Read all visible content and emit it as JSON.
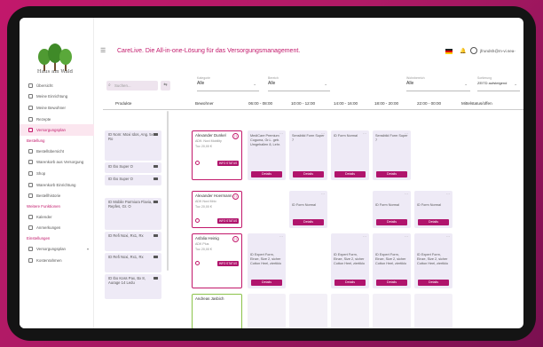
{
  "app": {
    "logo_text": "Haus am Wald",
    "tagline": "CareLive. Die All-in-one-Lösung für das Versorgungsmanagement.",
    "user": "jfrundsh@m-vi.sea-"
  },
  "sidebar": {
    "items": [
      {
        "label": "Übersicht"
      },
      {
        "label": "Meine Einrichtung"
      },
      {
        "label": "Meine Bewohner"
      },
      {
        "label": "Rezepte"
      },
      {
        "label": "Versorgungsplan",
        "active": true
      }
    ],
    "section1": "Bestellung",
    "items2": [
      {
        "label": "Bestellübersicht"
      },
      {
        "label": "Warenkorb aus Versorgung"
      },
      {
        "label": "Shop"
      },
      {
        "label": "Warenkorb Einrichtung"
      },
      {
        "label": "Bestellhistorie"
      }
    ],
    "section2": "Weitere Funktionen",
    "items3": [
      {
        "label": "Kalender"
      },
      {
        "label": "Anmerkungen"
      }
    ],
    "section3": "Einstellungen",
    "items4": [
      {
        "label": "Versorgungsplan"
      },
      {
        "label": "Kostenrahmen"
      }
    ]
  },
  "filters": {
    "search_placeholder": "Suchen...",
    "category": {
      "label": "Kategorie",
      "value": "Alle"
    },
    "section": {
      "label": "Bereich",
      "value": "Alle"
    },
    "ward": {
      "label": "Wohnbereich",
      "value": "Alle"
    },
    "sort": {
      "label": "Sortierung",
      "value": "ZEITD aufsteigend"
    }
  },
  "table": {
    "headers": [
      "Produkte",
      "Bewohner",
      "06:00 - 08:00",
      "10:00 - 12:00",
      "14:00 - 16:00",
      "18:00 - 20:00",
      "22:00 - 00:00",
      "Mittelstatus/offen"
    ],
    "products": [
      "ID Nom: Moxi Idos, Ang. 5x Ro",
      "ID Ibo Super O",
      "ID Ibo Super O",
      "ID Mobile Parmiura Flavia, 8 Repfes, Gr. O",
      "ID Refi Noxi, Rx1, Rx",
      "ID Refi Noxi, Rx1, Rx",
      "ID Ibo Koss Pax, Bx 8, Aurage 14 Ledu"
    ],
    "residents": [
      {
        "name": "Alexander Dunkel",
        "annot": "ADK: Noxi Mobility",
        "info": "Tuc 20,00 €",
        "status": "INFO STATUS"
      },
      {
        "name": "Alexander Hoermann",
        "annot": "ADK Noxi Mrio",
        "info": "Tuc 20,00 €",
        "status": "INFO STATUS"
      },
      {
        "name": "Asfalia Heinig",
        "annot": "ADK Plus",
        "info": "Tuc 20,00 €",
        "status": "INFO STATUS"
      },
      {
        "name": "Andreas Jasbich",
        "annot": "",
        "info": "",
        "status": ""
      }
    ],
    "cells": {
      "r1": [
        "MediCare Premium Coguma, Gr.L. geb. Umgehallen 8, Lehr.",
        "Sensiblid Form Super 7",
        "ID Form Normal",
        "Sensiblid Form Super 7"
      ],
      "r2": [
        "ID Form Normal",
        "ID Form Normal",
        "ID Form Normal"
      ],
      "r3": [
        "ID Expert Form, Einze, Size 2, sicher Cotton Heel, ziertiklo",
        "ID Expert Form, Einze, Size 2, sicher Cotton Heel, ziertiklo",
        "ID Expert Form, Einze, Size 2, sicher Cotton Heel, ziertiklo",
        "ID Expert Form, Einze, Size 2, sicher Cotton Heel, ziertiklo"
      ]
    },
    "details_label": "Details"
  },
  "colors": {
    "accent": "#c2186b",
    "button": "#b0146c",
    "cell_bg": "#eeeaf6"
  }
}
